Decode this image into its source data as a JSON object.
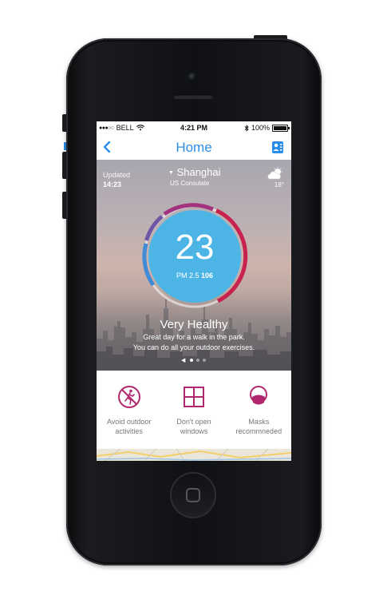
{
  "status_bar": {
    "signal_dots": "●●●○○",
    "carrier": "BELL",
    "time": "4:21 PM",
    "battery_percent": "100%"
  },
  "nav": {
    "title": "Home"
  },
  "update": {
    "label": "Updated",
    "time": "14:23"
  },
  "location": {
    "city": "Shanghai",
    "station": "US Consulate"
  },
  "weather": {
    "temperature": "18°",
    "icon": "partly-cloudy-icon"
  },
  "aqi": {
    "value": "23",
    "pollutant": "PM 2.5",
    "concentration": "106"
  },
  "status": {
    "title": "Very Healthy",
    "line1": "Great day for a walk in the park.",
    "line2": "You can do all your outdoor exercises."
  },
  "pager": {
    "pages": 3,
    "active": 0
  },
  "advice": [
    {
      "label_line1": "Avoid outdoor",
      "label_line2": "activities",
      "icon": "no-running-icon"
    },
    {
      "label_line1": "Don't open",
      "label_line2": "windows",
      "icon": "window-icon"
    },
    {
      "label_line1": "Masks",
      "label_line2": "recommneded",
      "icon": "mask-icon"
    }
  ],
  "colors": {
    "accent": "#2a8ee8",
    "aqi_circle": "#4db5e6",
    "advice_icon": "#b0276d"
  }
}
